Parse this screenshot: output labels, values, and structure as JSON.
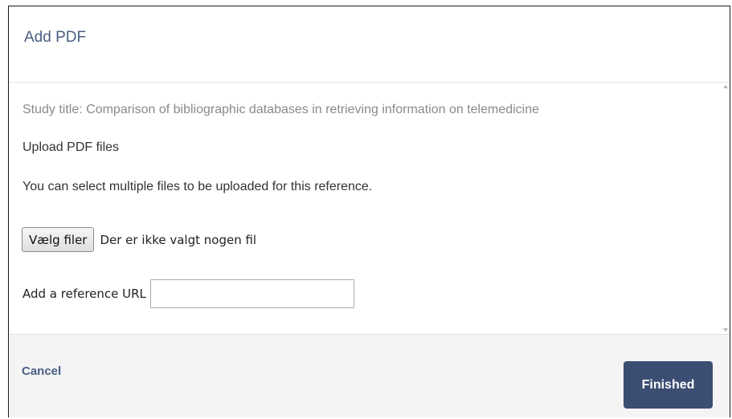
{
  "dialog": {
    "title": "Add PDF"
  },
  "body": {
    "study_title": "Study title: Comparison of bibliographic databases in retrieving information on telemedicine",
    "upload_heading": "Upload PDF files",
    "upload_description": "You can select multiple files to be uploaded for this reference.",
    "file_picker": {
      "button_label": "Vælg filer",
      "status_text": "Der er ikke valgt nogen fil"
    },
    "reference_url": {
      "label": "Add a reference URL",
      "value": ""
    }
  },
  "footer": {
    "cancel_label": "Cancel",
    "finished_label": "Finished"
  },
  "colors": {
    "accent": "#4a5f82",
    "primary_button": "#3b4e72",
    "footer_bg": "#f4f4f5"
  },
  "icons": [
    "scroll-up-arrow-icon",
    "scroll-down-arrow-icon"
  ]
}
